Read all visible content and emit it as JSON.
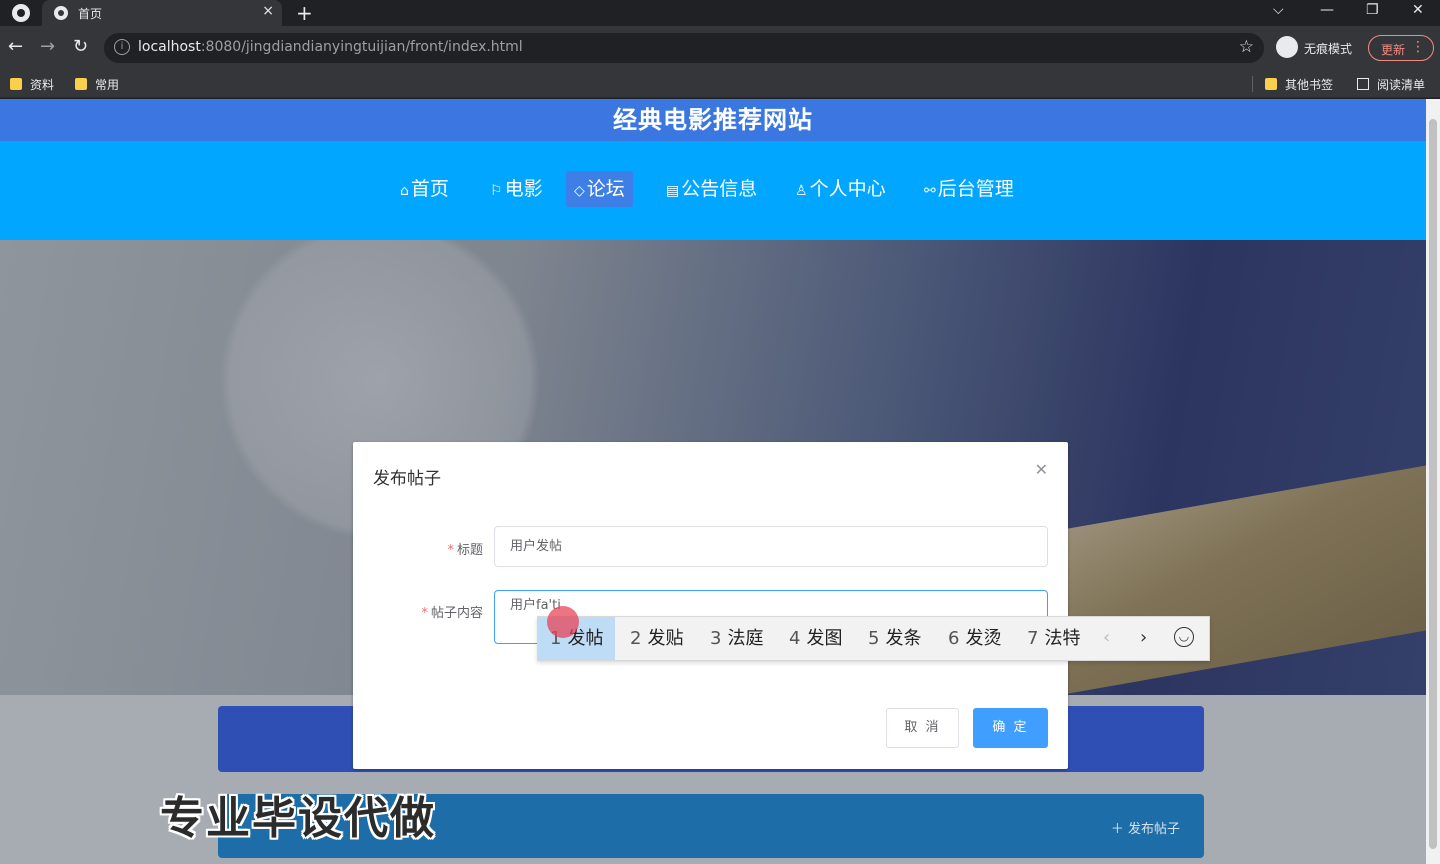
{
  "browser": {
    "tab_title": "首页",
    "tab_close": "×",
    "new_tab": "+",
    "url_host": "localhost",
    "url_rest": ":8080/jingdiandianyingtuijian/front/index.html",
    "profile_label": "无痕模式",
    "update_label": "更新",
    "bookmarks": [
      "资料",
      "常用"
    ],
    "other_bookmarks": "其他书签",
    "reading_list": "阅读清单"
  },
  "site": {
    "title": "经典电影推荐网站",
    "nav": [
      {
        "label": "首页",
        "icon": "home-icon"
      },
      {
        "label": "电影",
        "icon": "flag-icon"
      },
      {
        "label": "论坛",
        "icon": "tag-icon"
      },
      {
        "label": "公告信息",
        "icon": "notice-icon"
      },
      {
        "label": "个人中心",
        "icon": "user-icon"
      },
      {
        "label": "后台管理",
        "icon": "link-icon"
      }
    ],
    "active_nav": "论坛",
    "post_button": "发布帖子",
    "watermark": "专业毕设代做"
  },
  "dialog": {
    "title": "发布帖子",
    "title_label": "标题",
    "title_value": "用户发帖",
    "content_label": "帖子内容",
    "content_value": "用户fa'ti",
    "cancel": "取 消",
    "confirm": "确 定"
  },
  "ime": {
    "candidates": [
      {
        "num": "1",
        "text": "发帖"
      },
      {
        "num": "2",
        "text": "发贴"
      },
      {
        "num": "3",
        "text": "法庭"
      },
      {
        "num": "4",
        "text": "发图"
      },
      {
        "num": "5",
        "text": "发条"
      },
      {
        "num": "6",
        "text": "发烫"
      },
      {
        "num": "7",
        "text": "法特"
      }
    ],
    "selected_index": 0
  },
  "colors": {
    "header_blue": "#3b77e0",
    "nav_blue": "#00a6ff",
    "primary": "#409eff"
  }
}
